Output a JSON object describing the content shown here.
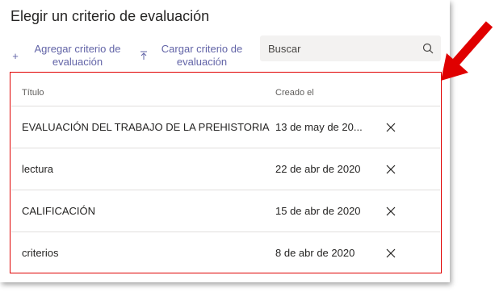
{
  "dialog": {
    "title": "Elegir un criterio de evaluación",
    "add_label": "Agregar criterio de evaluación",
    "upload_label": "Cargar criterio de evaluación",
    "search_placeholder": "Buscar"
  },
  "icons": {
    "add": "plus-icon",
    "upload": "upload-icon",
    "search": "search-icon",
    "delete": "close-icon",
    "annotation": "red-arrow-icon"
  },
  "colors": {
    "accent": "#6264a7",
    "annotation": "#e00000"
  },
  "table": {
    "columns": [
      "Título",
      "Creado el"
    ],
    "rows": [
      {
        "title": "EVALUACIÓN DEL TRABAJO DE LA PREHISTORIA",
        "created": "13 de may de 20..."
      },
      {
        "title": "lectura",
        "created": "22 de abr de 2020"
      },
      {
        "title": "CALIFICACIÓN",
        "created": "15 de abr de 2020"
      },
      {
        "title": "criterios",
        "created": "8 de abr de 2020"
      }
    ]
  }
}
